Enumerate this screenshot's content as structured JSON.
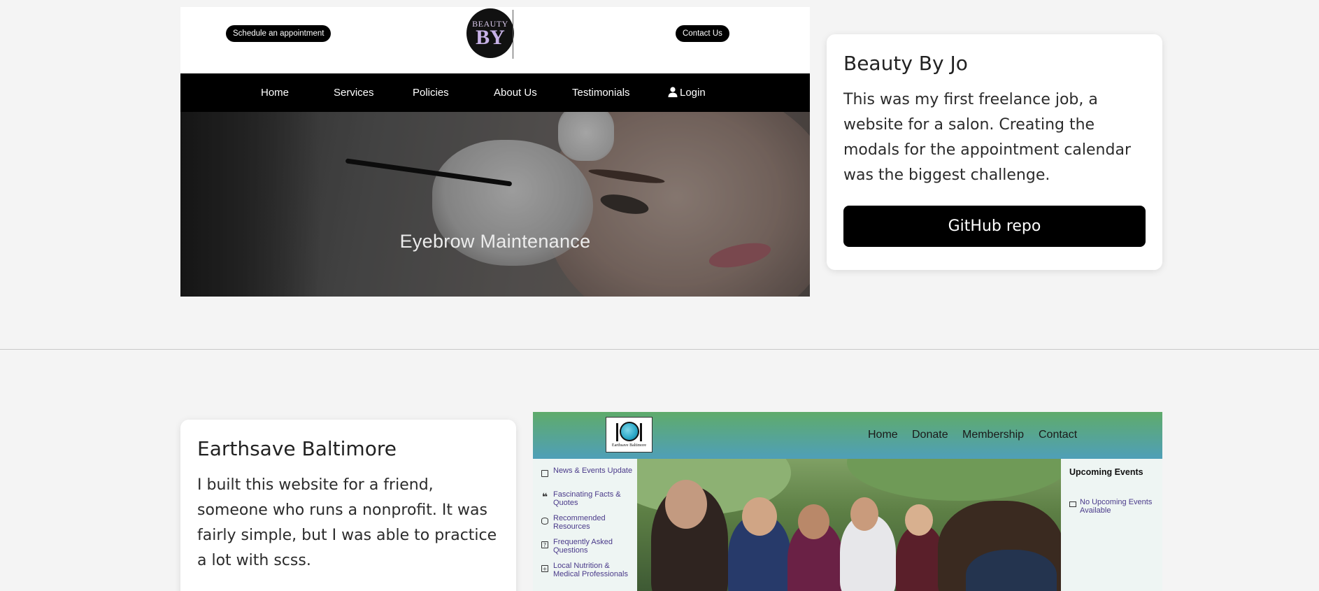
{
  "projects": [
    {
      "title": "Beauty By Jo",
      "description": "This was my first freelance job, a website for a salon. Creating the modals for the appointment calendar was the biggest challenge.",
      "button_label": "GitHub repo",
      "screenshot": {
        "header_buttons": {
          "schedule": "Schedule an appointment",
          "contact": "Contact Us"
        },
        "logo_text": {
          "top": "BEAUTY",
          "main": "BY"
        },
        "nav": [
          "Home",
          "Services",
          "Policies",
          "About Us",
          "Testimonials",
          "Login"
        ],
        "hero_title": "Eyebrow Maintenance"
      }
    },
    {
      "title": "Earthsave Baltimore",
      "description": "I built this website for a friend, someone who runs a nonprofit. It was fairly simple, but I was able to practice a lot with scss.",
      "screenshot": {
        "logo_caption": "Earthsave Baltimore",
        "nav": [
          "Home",
          "Donate",
          "Membership",
          "Contact"
        ],
        "sidebar": [
          {
            "icon": "newspaper-icon",
            "label": "News & Events Update"
          },
          {
            "icon": "quote-icon",
            "label": "Fascinating Facts & Quotes"
          },
          {
            "icon": "database-icon",
            "label": "Recommended Resources"
          },
          {
            "icon": "question-icon",
            "label": "Frequently Asked Questions"
          },
          {
            "icon": "medical-icon",
            "label": "Local Nutrition & Medical Professionals"
          }
        ],
        "events_title": "Upcoming Events",
        "events_empty": "No Upcoming Events Available"
      }
    }
  ]
}
